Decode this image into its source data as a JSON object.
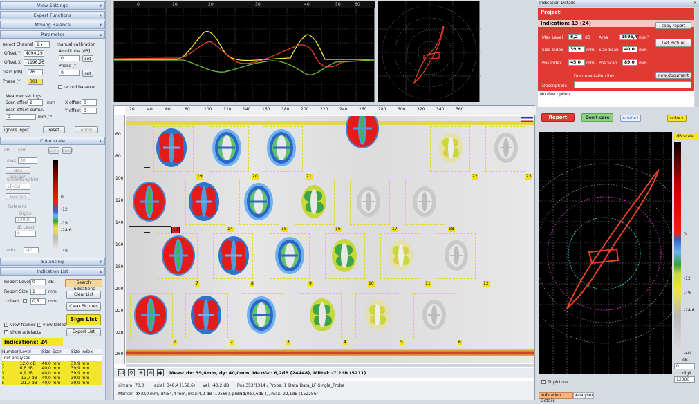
{
  "left_panel": {
    "view_settings": "View Settings",
    "expert_functions": "Expert Functions",
    "moving_balance": "Moving Balance",
    "parameter": "Parameter",
    "select_channel_label": "select Channel",
    "select_channel_value": "1",
    "manual_calibration": "manual calibration",
    "offset_y_label": "Offset Y",
    "offset_y": "4094,29",
    "offset_x_label": "Offset X",
    "offset_x": "-1196,26",
    "gain_label": "Gain [dB]",
    "gain": "26",
    "phase_label": "Phase [°]",
    "phase": "301",
    "amplitude_label": "Amplitude [dB]",
    "amplitude": "0",
    "phase2_label": "Phase [°]",
    "phase2": "0",
    "set1": "set",
    "set2": "set",
    "record_balance": "record balance",
    "meander_settings": "Meander settings",
    "scan_offset_label": "Scan offset",
    "scan_offset": "2",
    "scan_offset_unit": "mm",
    "scan_offset_cumul_label": "Scan offset cumul.",
    "scan_offset_cumul": "0",
    "scan_offset_cumul_unit": "mm / °",
    "x_offset_label": "X offset",
    "x_offset": "0",
    "y_offset_label": "Y offset",
    "y_offset": "0",
    "ignore_input": "ignore input",
    "reset": "reset",
    "apply": "Apply",
    "color_scale": "Color scale",
    "db_label": "dB",
    "sym_label": "sym",
    "save": "save",
    "reset2": "reset",
    "max_label": "max",
    "max_value": "30",
    "neu_anlegen": "Neu anlegen",
    "schema_waehlen": "Schema wählen",
    "schema_value": "LF-Coil",
    "loeschen": "löschen",
    "referenz": "Referenz",
    "digits_label": "Digits",
    "digits_value": "12000",
    "db_level_label": "dB Level",
    "db_level_value": "0",
    "min_label": "min",
    "min_value": "-40",
    "scale_ticks": [
      "0",
      "-12",
      "-19",
      "-24,6",
      "-40"
    ],
    "balancing": "Balancing",
    "indication_list": "Indication List",
    "report_level_label": "Report Level",
    "report_level": "0",
    "report_level_unit": "dB",
    "report_size_label": "Report Size",
    "report_size": "1",
    "report_size_unit": "mm",
    "collect_label": "collect",
    "collect_value": "0,5",
    "collect_unit": "mm",
    "search_indications": "Search indications",
    "clear_list": "Clear List",
    "clear_pictures": "Clear Pictures",
    "sign_list": "Sign List",
    "export_list": "Export List",
    "view_frames": "view frames",
    "view_lables": "view lables",
    "show_artefacts": "show artefacts",
    "indications_count": "Indications: 24",
    "table_headers": [
      "Number",
      "Level",
      "Size-Scan",
      "Size-Index"
    ],
    "not_analysed": "not analysed",
    "rows": [
      [
        "1",
        "12,0 dB",
        "40,0 mm",
        "39,9 mm"
      ],
      [
        "2",
        "6,6 dB",
        "40,0 mm",
        "39,9 mm"
      ],
      [
        "3",
        "0,9 dB",
        "40,0 mm",
        "39,9 mm"
      ],
      [
        "4",
        "-13,7 dB",
        "40,0 mm",
        "39,9 mm"
      ],
      [
        "5",
        "-21,7 dB",
        "40,0 mm",
        "39,9 mm"
      ]
    ]
  },
  "signal_plot": {
    "x_ticks": [
      "0",
      "10",
      "20",
      "30",
      "40",
      "50",
      "60"
    ],
    "colors": {
      "yellow": "#f5e83a",
      "red": "#e8402a",
      "green": "#6fbf3a"
    }
  },
  "scan_view": {
    "x_ticks": [
      "20",
      "40",
      "60",
      "80",
      "100",
      "120",
      "140",
      "160",
      "180",
      "200",
      "220",
      "240",
      "260",
      "280",
      "300",
      "320",
      "340",
      "360"
    ],
    "y_ticks": [
      "60",
      "80",
      "100",
      "120",
      "140",
      "160",
      "180",
      "200",
      "220",
      "240",
      "260"
    ],
    "labels": [
      "1",
      "2",
      "3",
      "4",
      "5",
      "6",
      "7",
      "8",
      "9",
      "10",
      "11",
      "12",
      "13",
      "14",
      "15",
      "16",
      "17",
      "18",
      "19",
      "20",
      "21",
      "22",
      "23"
    ],
    "measure_text": "Meas: dx: 39,8mm, dy: 40,0mm, MaxVal: 6,2dB (24448), Mittel: -7,2dB (5211)",
    "status1": {
      "circum": "circum: 70,0",
      "axial": "axial: 348,4 (158,6)",
      "val": "Val: -40,2 dB",
      "pos": "Pos:353/1314 / Probe: 1",
      "data": "Data:Data_LF-Single_Probe"
    },
    "status2": {
      "marker": "Marker: dX:0,0 mm, dY:54,4 mm, max:4,2 dB (19566), phi:59,0°",
      "minmax": "min: -67,6dB (), max: 22,1dB (152256)"
    }
  },
  "right_panel": {
    "title": "Indication Details",
    "project_label": "Project:",
    "indication_label": "Indication: 13 (24)",
    "copy_report": "copy report",
    "max_level_label": "Max Level",
    "max_level": "6,2",
    "max_level_unit": "dB",
    "area_label": "Area",
    "area": "1596,4",
    "area_unit": "mm²",
    "get_picture": "Get Picture",
    "size_index_label": "Size Index",
    "size_index": "39,9",
    "size_index_unit": "mm",
    "size_scan_label": "Size Scan",
    "size_scan": "40,0",
    "size_scan_unit": "mm",
    "pos_index_label": "Pos Index",
    "pos_index": "45,0",
    "pos_index_unit": "mm",
    "pos_scan_label": "Pos Scan",
    "pos_scan": "89,0",
    "pos_scan_unit": "mm",
    "documentation_link": "Documentation link:",
    "new_document": "new document",
    "description_label": "Description:",
    "no_description": "No description",
    "report": "Report",
    "dont_care": "Don't care",
    "artefact": "Artefact",
    "unlock": "unlock",
    "db_scale": "dB scale",
    "scale_ticks": [
      "0",
      "-12",
      "-19",
      "-24,6",
      "-40"
    ],
    "db_unit": "dB",
    "db_box": "0",
    "digit_label": "digit",
    "digit_box": "12000",
    "fit_picture": "fit picture",
    "tab_indication": "Indication Details",
    "tab_analyser": "Analyser"
  }
}
